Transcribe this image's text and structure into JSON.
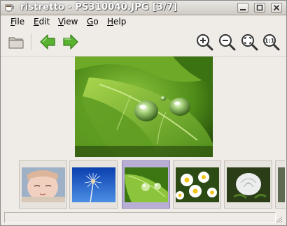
{
  "window": {
    "title": "ristretto - PS310040.JPG [3/7]"
  },
  "menu": [
    {
      "label": "File",
      "underline": "F",
      "rest": "ile"
    },
    {
      "label": "Edit",
      "underline": "E",
      "rest": "dit"
    },
    {
      "label": "View",
      "underline": "V",
      "rest": "iew"
    },
    {
      "label": "Go",
      "underline": "G",
      "rest": "o"
    },
    {
      "label": "Help",
      "underline": "H",
      "rest": "elp"
    }
  ],
  "toolbar": {
    "icons": [
      "open-folder-icon",
      "back-arrow-icon",
      "forward-arrow-icon",
      "zoom-in-icon",
      "zoom-out-icon",
      "zoom-fit-icon",
      "zoom-100-icon"
    ],
    "arrow_color": "#4fa82b",
    "zoom_100_label": "1:1"
  },
  "thumbnails": [
    {
      "subject": "baby",
      "selected": false
    },
    {
      "subject": "dandelion",
      "selected": false
    },
    {
      "subject": "leaf with water drops",
      "selected": true
    },
    {
      "subject": "daisies",
      "selected": false
    },
    {
      "subject": "white rose",
      "selected": false
    }
  ],
  "status": {
    "text": ""
  },
  "colors": {
    "selection": "#b8aed6",
    "window_bg": "#efebe7"
  }
}
